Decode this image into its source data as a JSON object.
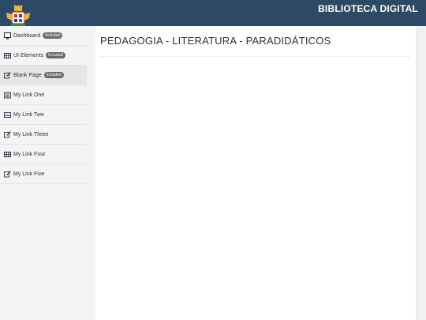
{
  "header": {
    "title": "BIBLIOTECA DIGITAL",
    "logo_icon": "coat-of-arms-icon"
  },
  "sidebar": {
    "items": [
      {
        "label": "Dashboard",
        "badge": "Included",
        "icon": "desktop-icon"
      },
      {
        "label": "UI Elements",
        "badge": "Included",
        "icon": "table-icon"
      },
      {
        "label": "Blank Page",
        "badge": "Included",
        "icon": "edit-icon"
      },
      {
        "label": "My Link One",
        "icon": "list-icon"
      },
      {
        "label": "My Link Two",
        "icon": "picture-icon"
      },
      {
        "label": "My Link Three",
        "icon": "edit-icon"
      },
      {
        "label": "My Link Four",
        "icon": "table-icon"
      },
      {
        "label": "My Link Five",
        "icon": "edit-icon"
      }
    ]
  },
  "main": {
    "title": "PEDAGOGIA - LITERATURA - PARADIDÁTICOS"
  },
  "colors": {
    "topbar": "#2c4a63",
    "badge": "#6b6b6b"
  }
}
